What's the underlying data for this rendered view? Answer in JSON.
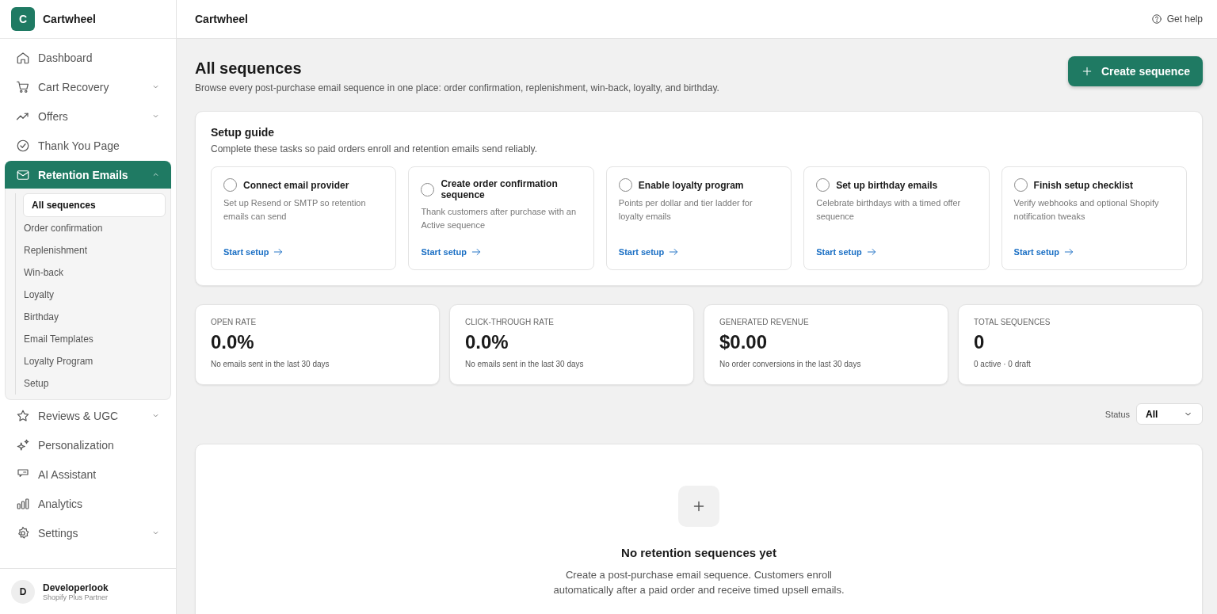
{
  "brand": {
    "logo_letter": "C",
    "name": "Cartwheel"
  },
  "sidebar": {
    "items": [
      {
        "label": "Dashboard",
        "selected": false
      },
      {
        "label": "Cart Recovery",
        "selected": false,
        "expanded": false
      },
      {
        "label": "Offers",
        "selected": false,
        "expanded": false
      },
      {
        "label": "Thank You Page",
        "selected": false
      },
      {
        "label": "Retention Emails",
        "selected": true,
        "expanded": true,
        "children": [
          {
            "label": "All sequences",
            "selected": true
          },
          {
            "label": "Order confirmation",
            "selected": false
          },
          {
            "label": "Replenishment",
            "selected": false
          },
          {
            "label": "Win-back",
            "selected": false
          },
          {
            "label": "Loyalty",
            "selected": false
          },
          {
            "label": "Birthday",
            "selected": false
          },
          {
            "label": "Email Templates",
            "selected": false
          },
          {
            "label": "Loyalty Program",
            "selected": false
          },
          {
            "label": "Setup",
            "selected": false
          }
        ]
      },
      {
        "label": "Reviews & UGC",
        "selected": false,
        "expanded": false
      },
      {
        "label": "Personalization",
        "selected": false
      },
      {
        "label": "AI Assistant",
        "selected": false
      },
      {
        "label": "Analytics",
        "selected": false
      },
      {
        "label": "Settings",
        "selected": false,
        "expanded": false
      }
    ],
    "user": {
      "initial": "D",
      "name": "Developerlook",
      "role": "Shopify Plus Partner"
    }
  },
  "header": {
    "title": "Cartwheel",
    "help": "Get help"
  },
  "page": {
    "title": "All sequences",
    "subtitle": "Browse every post-purchase email sequence in one place: order confirmation, replenishment, win-back, loyalty, and birthday.",
    "primary_button": "Create sequence"
  },
  "setup_guide": {
    "title": "Setup guide",
    "subtitle": "Complete these tasks so paid orders enroll and retention emails send reliably.",
    "tasks": [
      {
        "title": "Connect email provider",
        "description": "Set up Resend or SMTP so retention emails can send",
        "link": "Start setup",
        "checked": false
      },
      {
        "title": "Create order confirmation sequence",
        "description": "Thank customers after purchase with an Active sequence",
        "link": "Start setup",
        "checked": false
      },
      {
        "title": "Enable loyalty program",
        "description": "Points per dollar and tier ladder for loyalty emails",
        "link": "Start setup",
        "checked": false
      },
      {
        "title": "Set up birthday emails",
        "description": "Celebrate birthdays with a timed offer sequence",
        "link": "Start setup",
        "checked": false
      },
      {
        "title": "Finish setup checklist",
        "description": "Verify webhooks and optional Shopify notification tweaks",
        "link": "Start setup",
        "checked": false
      }
    ]
  },
  "stats": [
    {
      "label": "OPEN RATE",
      "value": "0.0%",
      "note": "No emails sent in the last 30 days"
    },
    {
      "label": "CLICK-THROUGH RATE",
      "value": "0.0%",
      "note": "No emails sent in the last 30 days"
    },
    {
      "label": "GENERATED REVENUE",
      "value": "$0.00",
      "note": "No order conversions in the last 30 days"
    },
    {
      "label": "TOTAL SEQUENCES",
      "value": "0",
      "note": "0 active · 0 draft"
    }
  ],
  "filter": {
    "label": "Status",
    "value": "All"
  },
  "empty_state": {
    "title": "No retention sequences yet",
    "description": "Create a post-purchase email sequence. Customers enroll automatically after a paid order and receive timed upsell emails."
  }
}
